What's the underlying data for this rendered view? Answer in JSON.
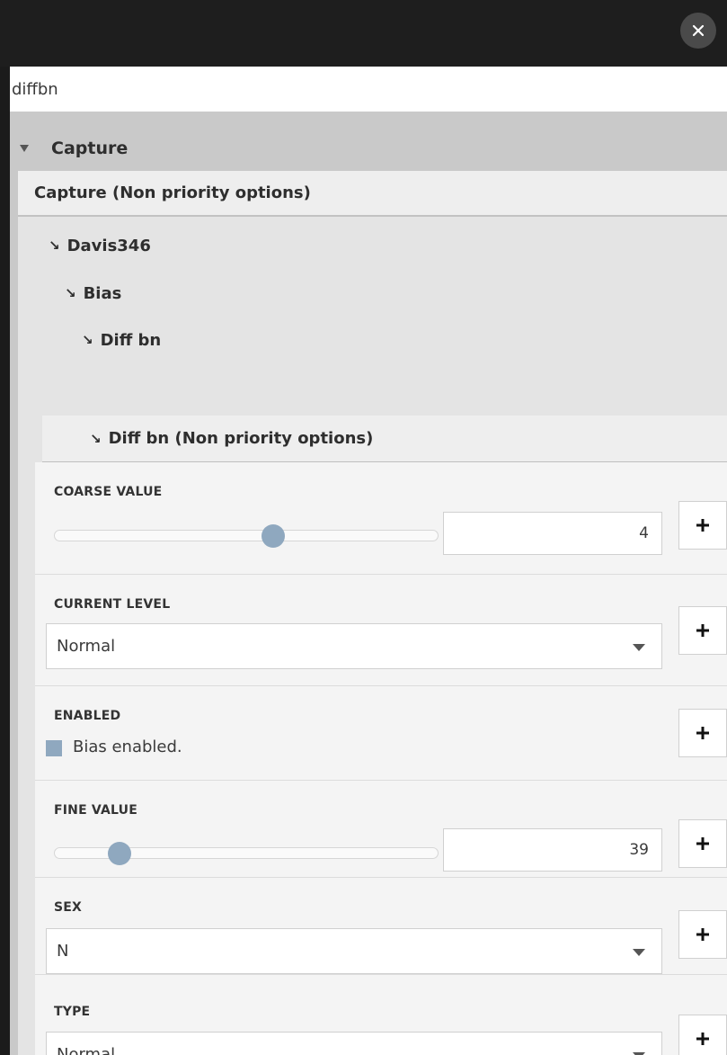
{
  "search": {
    "value": "diffbn"
  },
  "section": {
    "title": "Capture"
  },
  "subpanel": {
    "title": "Capture (Non priority options)"
  },
  "tree": [
    {
      "label": "Davis346",
      "arrow": "↘"
    },
    {
      "label": "Bias",
      "arrow": "↘"
    },
    {
      "label": "Diff bn",
      "arrow": "↘"
    }
  ],
  "leaf": {
    "label": "Diff bn (Non priority options)",
    "arrow": "↘"
  },
  "options": {
    "coarse": {
      "label": "COARSE VALUE",
      "value": "4",
      "level": 0.57
    },
    "current": {
      "label": "CURRENT LEVEL",
      "selected": "Normal"
    },
    "enabled": {
      "label": "ENABLED",
      "checkbox_label": "Bias enabled."
    },
    "fine": {
      "label": "FINE VALUE",
      "value": "39",
      "level": 0.17
    },
    "sex": {
      "label": "SEX",
      "selected": "N"
    },
    "type": {
      "label": "TYPE",
      "selected": "Normal"
    }
  },
  "colors": {
    "accent": "#8fa8bf",
    "titlebar": "#1e1e1e",
    "panel": "#c9c9c9"
  },
  "icons": {
    "close": "close-icon",
    "caret": "caret-down-icon",
    "plus": "plus-icon"
  }
}
